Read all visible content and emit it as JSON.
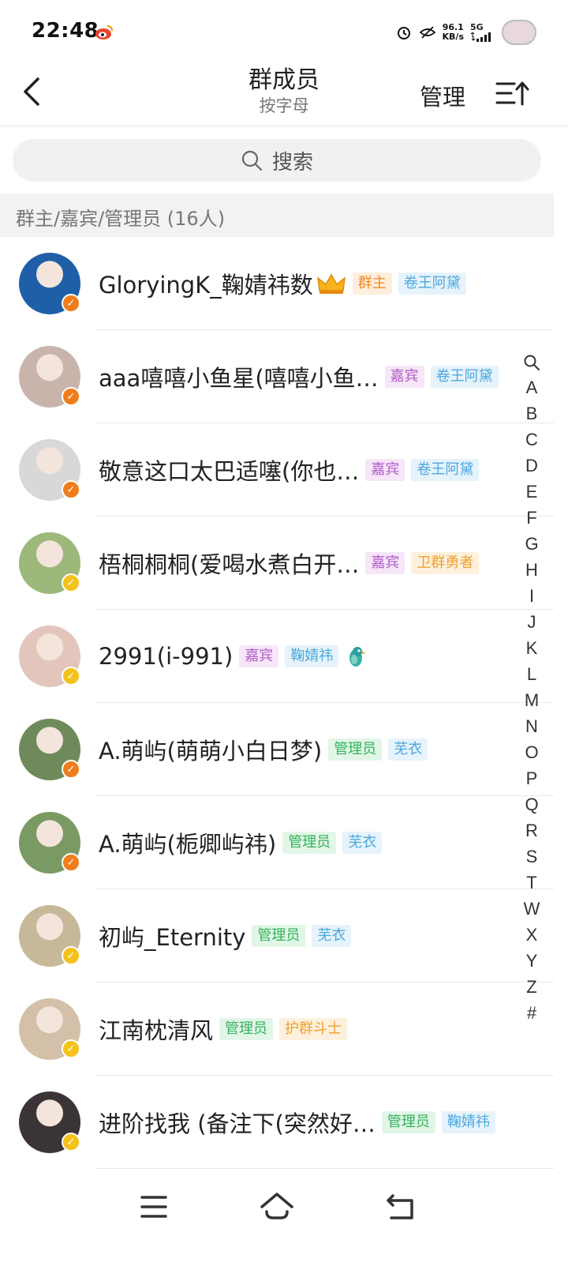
{
  "status_bar": {
    "time": "22:48",
    "net_speed_value": "96.1",
    "net_speed_unit": "KB/s",
    "network": "5G",
    "icons": [
      "weibo-icon",
      "alarm-icon",
      "eye-off-icon",
      "signal-icon",
      "profile-icon"
    ]
  },
  "header": {
    "title": "群成员",
    "subtitle": "按字母",
    "manage_label": "管理"
  },
  "search": {
    "placeholder": "搜索"
  },
  "section": {
    "label": "群主/嘉宾/管理员 (16人)"
  },
  "members": [
    {
      "name": "GloryingK_鞠婧祎数",
      "badge": "orange",
      "crown": true,
      "bird": false,
      "tags": [
        {
          "text": "群主",
          "style": "owner"
        },
        {
          "text": "卷王阿黛",
          "style": "blue"
        }
      ],
      "avatar_color": "#1f5fa8"
    },
    {
      "name": "aaa嘻嘻小鱼星(嘻嘻小鱼…",
      "badge": "orange",
      "crown": false,
      "bird": false,
      "tags": [
        {
          "text": "嘉宾",
          "style": "guest"
        },
        {
          "text": "卷王阿黛",
          "style": "blue"
        }
      ],
      "avatar_color": "#c9b4ac"
    },
    {
      "name": "敬意这口太巴适噻(你也…",
      "badge": "orange",
      "crown": false,
      "bird": false,
      "tags": [
        {
          "text": "嘉宾",
          "style": "guest"
        },
        {
          "text": "卷王阿黛",
          "style": "blue"
        }
      ],
      "avatar_color": "#d8d8d8"
    },
    {
      "name": "梧桐桐桐(爱喝水煮白开…",
      "badge": "gold",
      "crown": false,
      "bird": false,
      "tags": [
        {
          "text": "嘉宾",
          "style": "guest"
        },
        {
          "text": "卫群勇者",
          "style": "orange"
        }
      ],
      "avatar_color": "#9cb87a"
    },
    {
      "name": "2991(i-991)",
      "badge": "gold",
      "crown": false,
      "bird": true,
      "tags": [
        {
          "text": "嘉宾",
          "style": "guest"
        },
        {
          "text": "鞠婧祎",
          "style": "blue"
        }
      ],
      "avatar_color": "#e2c6bc"
    },
    {
      "name": "A.萌屿(萌萌小白日梦)",
      "badge": "orange",
      "crown": false,
      "bird": false,
      "tags": [
        {
          "text": "管理员",
          "style": "admin"
        },
        {
          "text": "芜衣",
          "style": "blue"
        }
      ],
      "avatar_color": "#6e8a5a"
    },
    {
      "name": "A.萌屿(栀卿屿祎)",
      "badge": "orange",
      "crown": false,
      "bird": false,
      "tags": [
        {
          "text": "管理员",
          "style": "admin"
        },
        {
          "text": "芜衣",
          "style": "blue"
        }
      ],
      "avatar_color": "#7a9a64"
    },
    {
      "name": "初屿_Eternity",
      "badge": "gold",
      "crown": false,
      "bird": false,
      "tags": [
        {
          "text": "管理员",
          "style": "admin"
        },
        {
          "text": "芜衣",
          "style": "blue"
        }
      ],
      "avatar_color": "#c8b89a"
    },
    {
      "name": "江南枕清风",
      "badge": "gold",
      "crown": false,
      "bird": false,
      "tags": [
        {
          "text": "管理员",
          "style": "admin"
        },
        {
          "text": "护群斗士",
          "style": "orange"
        }
      ],
      "avatar_color": "#d4c0a8"
    },
    {
      "name": "进阶找我 (备注下(突然好…",
      "badge": "gold",
      "crown": false,
      "bird": false,
      "tags": [
        {
          "text": "管理员",
          "style": "admin"
        },
        {
          "text": "鞠婧祎",
          "style": "blue"
        }
      ],
      "avatar_color": "#3a3436"
    }
  ],
  "alphabet": [
    "A",
    "B",
    "C",
    "D",
    "E",
    "F",
    "G",
    "H",
    "I",
    "J",
    "K",
    "L",
    "M",
    "N",
    "O",
    "P",
    "Q",
    "R",
    "S",
    "T",
    "W",
    "X",
    "Y",
    "Z",
    "#"
  ],
  "nav": {
    "buttons": [
      "menu-icon",
      "home-icon",
      "back-nav-icon"
    ]
  }
}
